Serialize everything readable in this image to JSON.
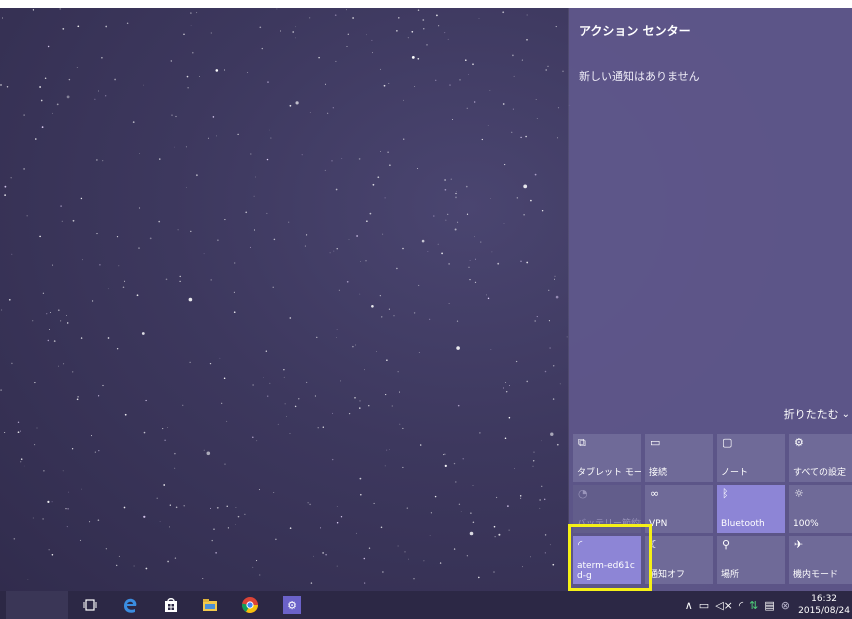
{
  "action_center": {
    "title": "アクション センター",
    "empty_message": "新しい通知はありません",
    "collapse_label": "折りたたむ",
    "tiles": [
      {
        "label": "タブレット モード",
        "icon": "tablet-mode-icon",
        "glyph": "⧉",
        "state": "off"
      },
      {
        "label": "接続",
        "icon": "connect-icon",
        "glyph": "▭",
        "state": "off"
      },
      {
        "label": "ノート",
        "icon": "note-icon",
        "glyph": "▢",
        "state": "off"
      },
      {
        "label": "すべての設定",
        "icon": "gear-icon",
        "glyph": "⚙",
        "state": "off"
      },
      {
        "label": "バッテリー節約機",
        "icon": "battery-saver-icon",
        "glyph": "◔",
        "state": "disabled"
      },
      {
        "label": "VPN",
        "icon": "vpn-icon",
        "glyph": "∞",
        "state": "off"
      },
      {
        "label": "Bluetooth",
        "icon": "bluetooth-icon",
        "glyph": "ᛒ",
        "state": "on"
      },
      {
        "label": "100%",
        "icon": "brightness-icon",
        "glyph": "☼",
        "state": "off"
      },
      {
        "label": "aterm-ed61cd-g",
        "icon": "wifi-icon",
        "glyph": "◜",
        "state": "on"
      },
      {
        "label": "通知オフ",
        "icon": "quiet-hours-icon",
        "glyph": "☾",
        "state": "off"
      },
      {
        "label": "場所",
        "icon": "location-icon",
        "glyph": "⚲",
        "state": "off"
      },
      {
        "label": "機内モード",
        "icon": "airplane-icon",
        "glyph": "✈",
        "state": "off"
      }
    ]
  },
  "taskbar": {
    "clock_time": "16:32",
    "clock_date": "2015/08/24"
  },
  "colors": {
    "panel": "#5f588c",
    "tile": "#6f6a98",
    "tile_active": "#8d85d6",
    "highlight": "#f5f017",
    "taskbar": "#2c2845"
  }
}
